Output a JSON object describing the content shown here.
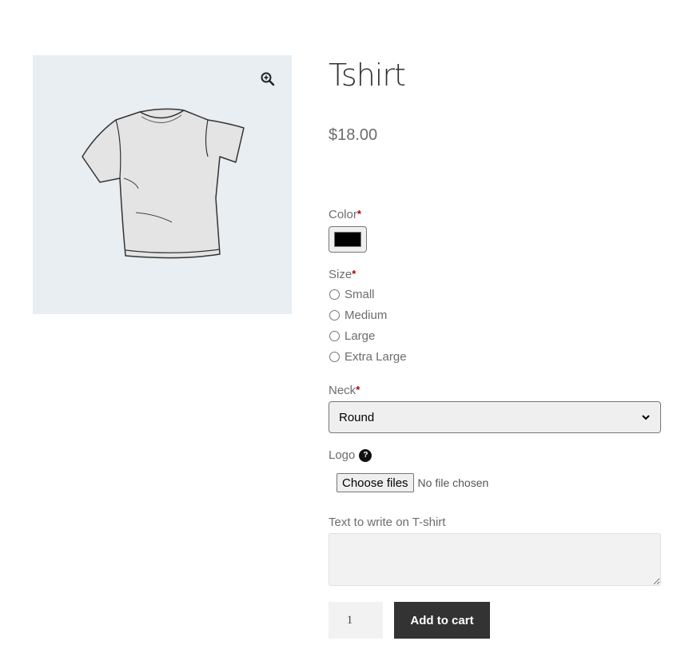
{
  "product": {
    "title": "Tshirt",
    "price": "$18.00",
    "image_alt": "tshirt-illustration",
    "gallery_bg": "#e8eef2"
  },
  "icons": {
    "zoom": "zoom-in-icon",
    "help": "?"
  },
  "form": {
    "required_mark": "*",
    "color": {
      "label": "Color",
      "value": "#000000"
    },
    "size": {
      "label": "Size",
      "options": [
        "Small",
        "Medium",
        "Large",
        "Extra Large"
      ],
      "selected": null
    },
    "neck": {
      "label": "Neck",
      "selected": "Round"
    },
    "logo": {
      "label": "Logo",
      "button_label": "Choose files",
      "status": "No file chosen"
    },
    "text": {
      "label": "Text to write on T-shirt",
      "value": ""
    },
    "quantity": "1",
    "add_to_cart_label": "Add to cart"
  },
  "colors": {
    "button_bg": "#333333",
    "required": "#aa0000"
  }
}
